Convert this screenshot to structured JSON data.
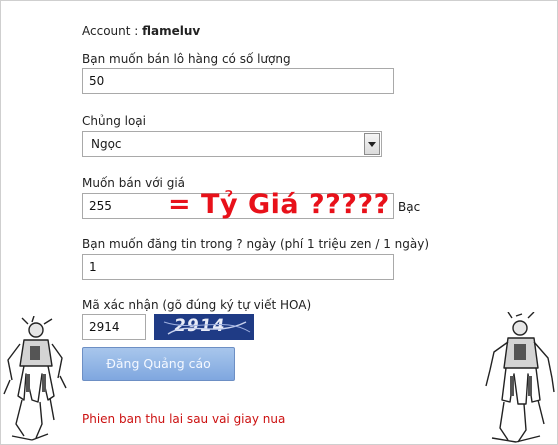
{
  "form": {
    "account_label": "Account : ",
    "account_name": "flameluv",
    "quantity_label": "Bạn muốn bán lô hàng có số lượng",
    "quantity_value": "50",
    "category_label": "Chủng loại",
    "category_value": "Ngọc",
    "price_label": "Muốn bán với giá",
    "price_value": "255",
    "price_overlay": "= Tỷ Giá ?????",
    "price_currency": "Bạc",
    "duration_label": "Bạn muốn đăng tin trong ? ngày (phí 1 triệu zen / 1 ngày)",
    "duration_value": "1",
    "captcha_label": "Mã xác nhận (gõ đúng ký tự viết HOA)",
    "captcha_value": "2914",
    "captcha_image_text": "2914",
    "submit_label": "Đăng Quảng cáo",
    "footer_note": "Phien ban thu lai sau vai giay nua"
  },
  "colors": {
    "overlay_red": "#e8111a",
    "captcha_bg": "#1f3b85",
    "button_blue": "#7fa7df",
    "note_red": "#cc1111"
  },
  "icons": {
    "left_sprite": "warrior-character-icon",
    "right_sprite": "warrior-character-icon"
  }
}
